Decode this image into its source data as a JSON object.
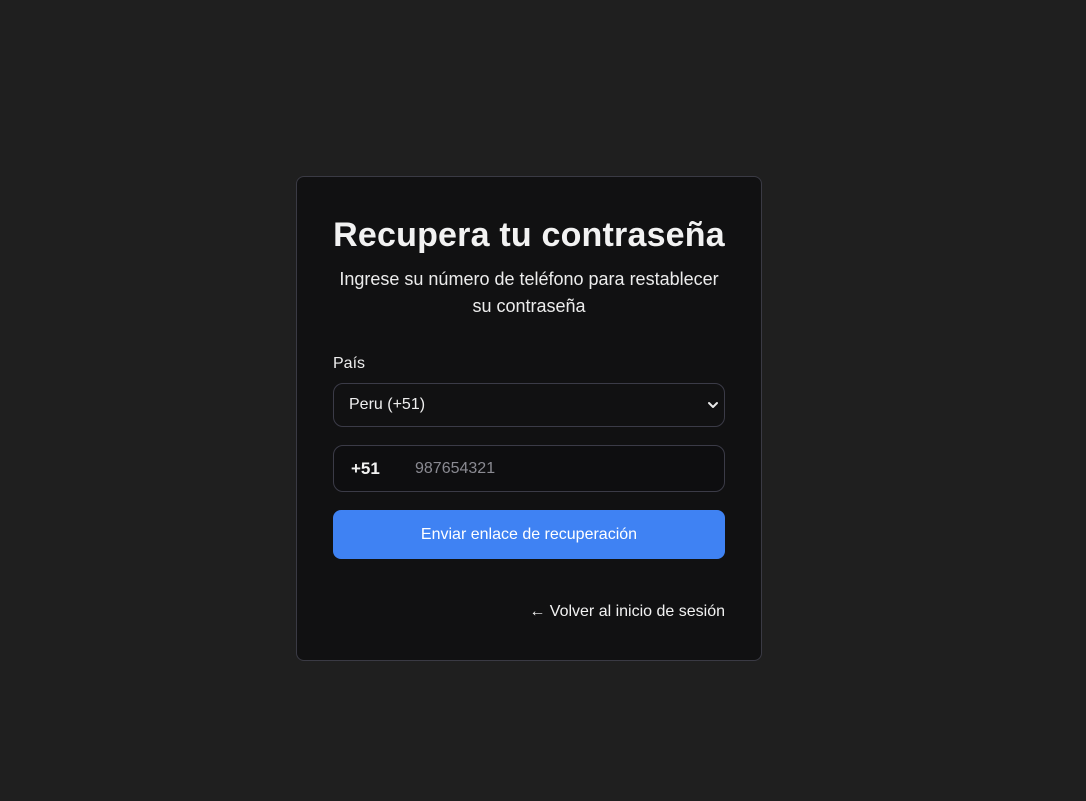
{
  "card": {
    "title": "Recupera tu contraseña",
    "subtitle": "Ingrese su número de teléfono para restablecer su contraseña"
  },
  "form": {
    "country_label": "País",
    "country_selected": "Peru (+51)",
    "phone_prefix": "+51",
    "phone_placeholder": "987654321",
    "phone_value": "",
    "submit_label": "Enviar enlace de recuperación"
  },
  "back_link": {
    "arrow": "←",
    "label": "Volver al inicio de sesión"
  },
  "icons": {
    "select_icon": "chevron-down-icon"
  },
  "colors": {
    "background": "#1f1f1f",
    "card": "#111112",
    "border": "#3b3b47",
    "accent": "#3f82f3"
  }
}
